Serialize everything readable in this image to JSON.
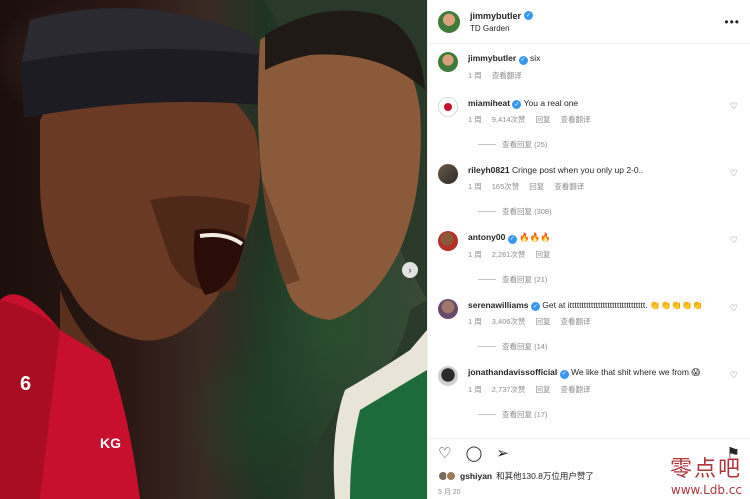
{
  "post": {
    "username": "jimmybutler",
    "location": "TD Garden",
    "caption_user": "jimmybutler",
    "caption_text": "six",
    "caption_time": "1 周",
    "caption_translate": "查看翻译"
  },
  "comments": [
    {
      "user": "miamiheat",
      "verified": true,
      "text": "You a real one",
      "time": "1 周",
      "likes": "9,414次赞",
      "reply": "回复",
      "translate": "查看翻译",
      "view_replies": "查看回复 (25)"
    },
    {
      "user": "rileyh0821",
      "verified": false,
      "text": "Cringe post when you only up 2-0..",
      "time": "1 周",
      "likes": "165次赞",
      "reply": "回复",
      "translate": "查看翻译",
      "view_replies": "查看回复 (308)"
    },
    {
      "user": "antony00",
      "verified": true,
      "text": "🔥🔥🔥",
      "time": "1 周",
      "likes": "2,261次赞",
      "reply": "回复",
      "translate": "",
      "view_replies": "查看回复 (21)"
    },
    {
      "user": "serenawilliams",
      "verified": true,
      "text": "Get at itttttttttttttttttttttttttttttttt. 👏👏👏👏👏",
      "time": "1 周",
      "likes": "3,406次赞",
      "reply": "回复",
      "translate": "查看翻译",
      "view_replies": "查看回复 (14)"
    },
    {
      "user": "jonathandavissofficial",
      "verified": true,
      "text": "We like that shit where we from 😱",
      "time": "1 周",
      "likes": "2,737次赞",
      "reply": "回复",
      "translate": "查看翻译",
      "view_replies": "查看回复 (17)"
    }
  ],
  "likes_summary": {
    "user": "gshiyan",
    "text": "和其他130.8万位用户赞了"
  },
  "date": "5 月 20",
  "watermark": {
    "cn": "零点吧",
    "url": "www.Ldb.cc"
  },
  "colors": {
    "verified": "#3897f0",
    "meta": "#8e8e8e",
    "heat_red": "#c8102e",
    "watermark": "#a0141a"
  },
  "icons": {
    "heart": "heart-icon",
    "comment": "comment-icon",
    "share": "share-icon",
    "bookmark": "bookmark-icon",
    "more": "more-icon",
    "next": "chevron-right-icon"
  }
}
